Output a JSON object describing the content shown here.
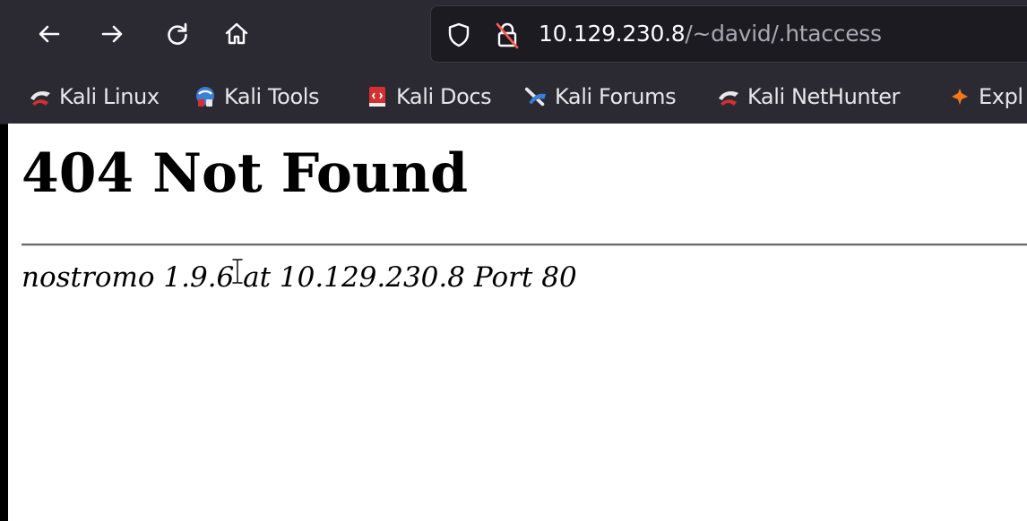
{
  "browser": {
    "nav": {
      "back": "back-arrow-icon",
      "forward": "forward-arrow-icon",
      "reload": "reload-icon",
      "home": "home-icon"
    },
    "url": {
      "host": "10.129.230.8",
      "path": "/~david/.htaccess",
      "security_icon": "shield-icon",
      "lock_icon": "insecure-lock-icon"
    },
    "bookmarks": [
      {
        "label": "Kali Linux",
        "icon": "kali-dragon-icon"
      },
      {
        "label": "Kali Tools",
        "icon": "kali-tools-icon"
      },
      {
        "label": "Kali Docs",
        "icon": "kali-docs-icon"
      },
      {
        "label": "Kali Forums",
        "icon": "kali-forums-icon"
      },
      {
        "label": "Kali NetHunter",
        "icon": "kali-dragon-icon"
      },
      {
        "label": "Expl",
        "icon": "exploit-db-icon"
      }
    ]
  },
  "page": {
    "heading": "404 Not Found",
    "address": "nostromo 1.9.6 at 10.129.230.8 Port 80"
  },
  "colors": {
    "chrome_bg": "#2b2a33",
    "urlbar_bg": "#1c1b22",
    "page_bg": "#ffffff",
    "kali_red": "#d62f2f",
    "kali_blue": "#3a7fd5"
  }
}
